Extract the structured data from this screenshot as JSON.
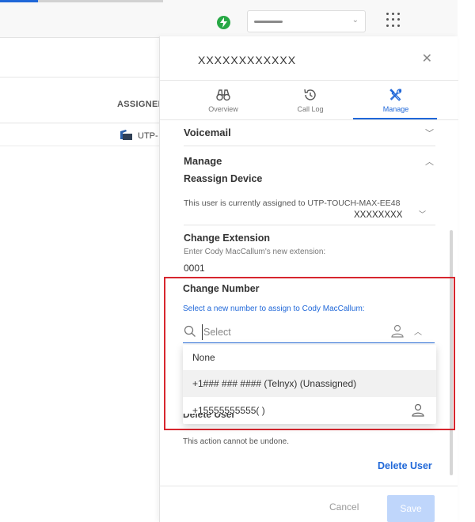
{
  "panel": {
    "title": "XXXXXXXXXXXX",
    "close_icon": "close-icon",
    "tabs": [
      {
        "label": "Overview",
        "icon": "binoculars-icon"
      },
      {
        "label": "Call Log",
        "icon": "history-icon"
      },
      {
        "label": "Manage",
        "icon": "tools-icon",
        "active": true
      }
    ],
    "voicemail": {
      "label": "Voicemail"
    },
    "manage": {
      "label": "Manage"
    },
    "reassign": {
      "label": "Reassign Device",
      "text": "This user is currently assigned to UTP-TOUCH-MAX-EE48",
      "device_value": "XXXXXXXX"
    },
    "change_extension": {
      "label": "Change Extension",
      "hint": "Enter Cody MacCallum's new extension:",
      "value": "0001"
    },
    "change_number": {
      "label": "Change Number",
      "hint": "Select a new number to assign to Cody MacCallum:",
      "placeholder": "Select",
      "options": [
        {
          "label": "None"
        },
        {
          "label": "+1### ### #### (Telnyx) (Unassigned)"
        },
        {
          "label": "+15555555555(  )"
        }
      ]
    },
    "delete_user": {
      "label": "Delete User",
      "warning": "This action cannot be undone.",
      "link": "Delete User"
    },
    "footer": {
      "cancel": "Cancel",
      "save": "Save"
    }
  },
  "background": {
    "column_header": "ASSIGNED",
    "device_cell": "UTP-"
  },
  "colors": {
    "accent": "#1f67d8",
    "highlight": "#d7262e",
    "status": "#27a845"
  }
}
